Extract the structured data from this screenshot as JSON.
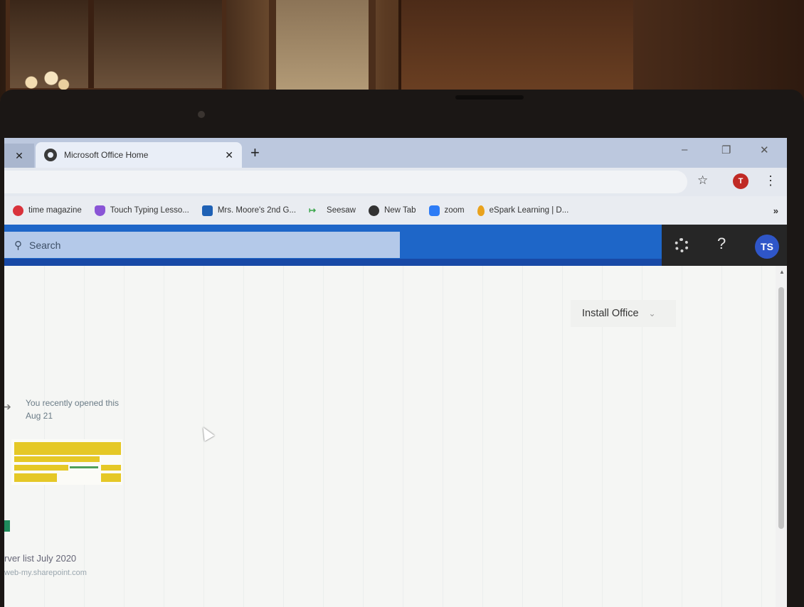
{
  "browser": {
    "active_tab_title": "Microsoft Office Home",
    "new_tab_glyph": "+",
    "window_controls": {
      "minimize": "–",
      "restore": "❐",
      "close": "✕"
    },
    "profile_initial": "T",
    "menu_glyph": "⋮",
    "star_glyph": "☆"
  },
  "bookmarks": {
    "items": [
      {
        "label": "time magazine",
        "icon": "time-icon"
      },
      {
        "label": "Touch Typing Lesso...",
        "icon": "typing-icon"
      },
      {
        "label": "Mrs. Moore's 2nd G...",
        "icon": "classroom-icon"
      },
      {
        "label": "Seesaw",
        "icon": "seesaw-icon"
      },
      {
        "label": "New Tab",
        "icon": "globe-icon"
      },
      {
        "label": "zoom",
        "icon": "zoom-icon"
      },
      {
        "label": "eSpark Learning | D...",
        "icon": "espark-icon"
      }
    ],
    "overflow": "»"
  },
  "office": {
    "search_placeholder": "Search",
    "help_glyph": "?",
    "avatar_initials": "TS",
    "install_label": "Install Office",
    "install_chevron": "⌄"
  },
  "recent": {
    "line1": "You recently opened this",
    "line2": "Aug 21",
    "file_name": "rver list July 2020",
    "file_path": "web-my.sharepoint.com"
  },
  "colors": {
    "office_blue": "#1e66c8",
    "header_dark": "#262626",
    "avatar_blue": "#2f56c8",
    "profile_red": "#c02a25"
  }
}
